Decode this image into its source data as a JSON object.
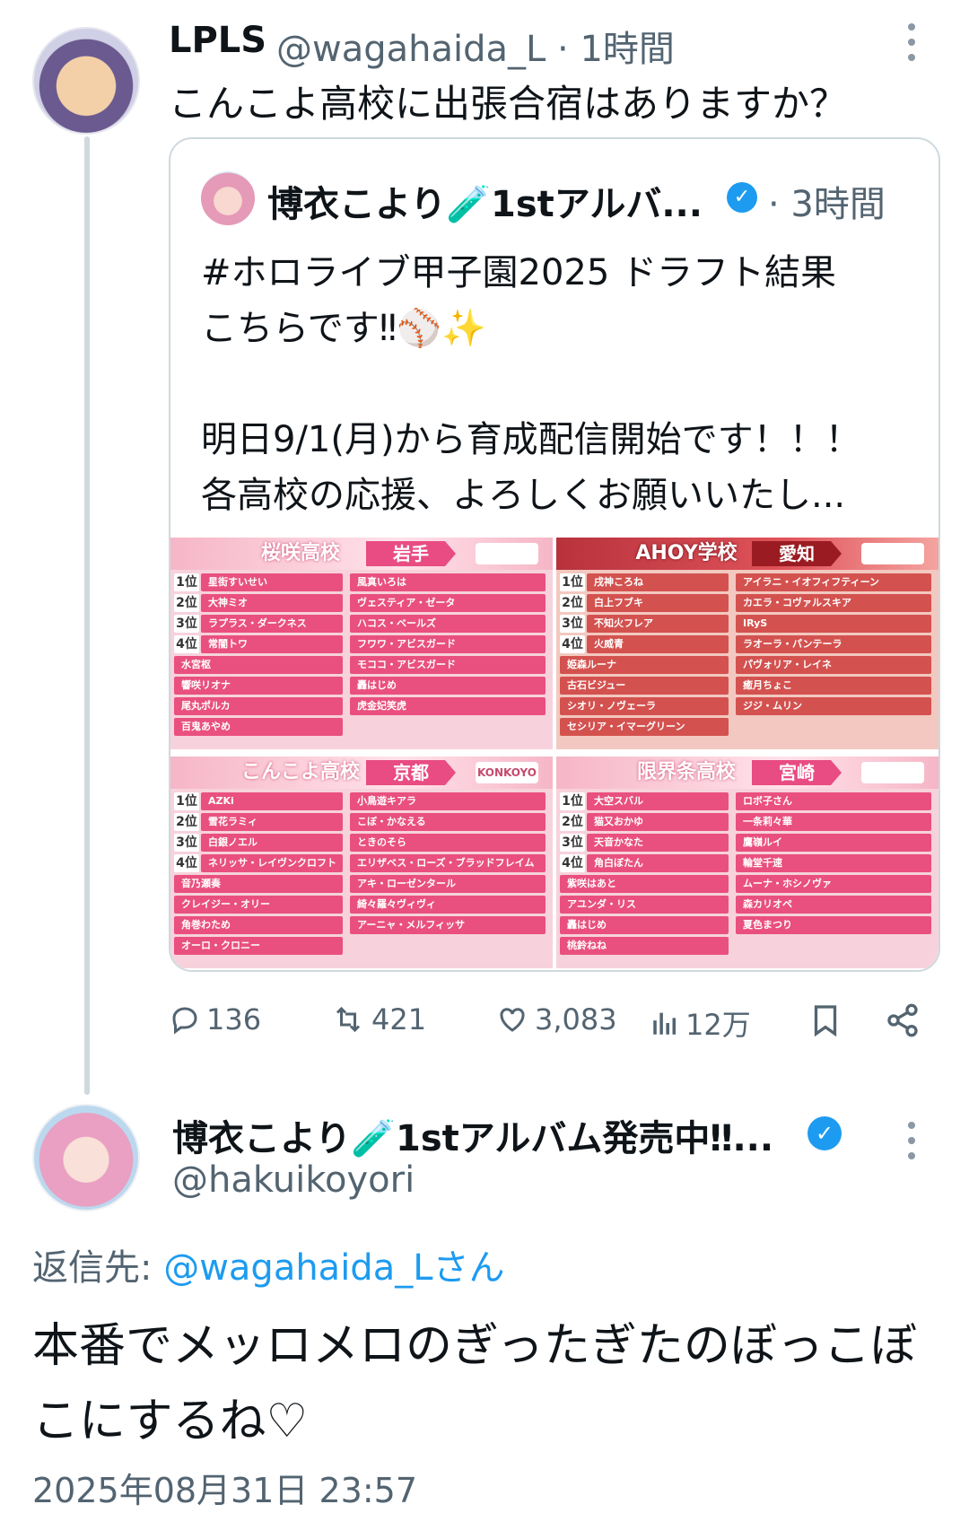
{
  "parent_tweet": {
    "name": "LPLS",
    "handle": "@wagahaida_L · 1時間",
    "text": "こんこよ高校に出張合宿はありますか？"
  },
  "quoted_tweet": {
    "name": "博衣こより🧪1stアルバ...",
    "time": "· 3時間",
    "text": "#ホロライブ甲子園2025 ドラフト結果\nこちらです‼⚾✨\n\n明日9/1(月)から育成配信開始です！！！\n各高校の応援、よろしくお願いいたし...",
    "image": {
      "panels": [
        {
          "title": "桜咲高校",
          "prefecture": "岩手",
          "logo": "",
          "ranked": [
            "星街すいせい",
            "大神ミオ",
            "ラプラス・ダークネス",
            "常闇トワ"
          ],
          "left_rest": [
            "水宮枢",
            "響咲リオナ",
            "尾丸ポルカ",
            "百鬼あやめ"
          ],
          "right": [
            "風真いろは",
            "ヴェスティア・ゼータ",
            "ハコス・ベールズ",
            "フワワ・アビスガード",
            "モココ・アビスガード",
            "轟はじめ",
            "虎金妃笑虎"
          ]
        },
        {
          "title": "AHOY学校",
          "prefecture": "愛知",
          "logo": "",
          "ranked": [
            "戌神ころね",
            "白上フブキ",
            "不知火フレア",
            "火威青"
          ],
          "left_rest": [
            "姫森ルーナ",
            "古石ビジュー",
            "シオリ・ノヴェーラ",
            "セシリア・イマーグリーン"
          ],
          "right": [
            "アイラニ・イオフィフティーン",
            "カエラ・コヴァルスキア",
            "IRyS",
            "ラオーラ・パンテーラ",
            "パヴォリア・レイネ",
            "癒月ちょこ",
            "ジジ・ムリン"
          ]
        },
        {
          "title": "こんこよ高校",
          "prefecture": "京都",
          "logo": "KONKOYO",
          "ranked": [
            "AZKi",
            "雪花ラミィ",
            "白銀ノエル",
            "ネリッサ・レイヴンクロフト"
          ],
          "left_rest": [
            "音乃瀬奏",
            "クレイジー・オリー",
            "角巻わため",
            "オーロ・クロニー"
          ],
          "right": [
            "小鳥遊キアラ",
            "こぼ・かなえる",
            "ときのそら",
            "エリザベス・ローズ・ブラッドフレイム",
            "アキ・ローゼンタール",
            "綺々羅々ヴィヴィ",
            "アーニャ・メルフィッサ"
          ]
        },
        {
          "title": "限界条高校",
          "prefecture": "宮崎",
          "logo": "",
          "ranked": [
            "大空スバル",
            "猫又おかゆ",
            "天音かなた",
            "角白ぼたん"
          ],
          "left_rest": [
            "紫咲はあと",
            "アユンダ・リス",
            "轟はじめ",
            "桃鈴ねね"
          ],
          "right": [
            "ロボ子さん",
            "一条莉々華",
            "鷹嶺ルイ",
            "輪堂千速",
            "ムーナ・ホシノヴァ",
            "森カリオペ",
            "夏色まつり"
          ]
        }
      ]
    }
  },
  "actions": {
    "replies": "136",
    "retweets": "421",
    "likes": "3,083",
    "views": "12万"
  },
  "reply_tweet": {
    "name": "博衣こより🧪1stアルバム発売中‼...",
    "handle": "@hakuikoyori",
    "reply_to_label": "返信先: ",
    "reply_to_mention": "@wagahaida_Lさん",
    "text": "本番でメッロメロのぎったぎたのぼっこぼこにするね♡",
    "timestamp": "2025年08月31日 23:57"
  },
  "icons": [
    "more-icon",
    "verified-icon",
    "reply-icon",
    "retweet-icon",
    "like-icon",
    "views-icon",
    "bookmark-icon",
    "share-icon"
  ],
  "colors": {
    "accent": "#1d9bf0",
    "secondary_text": "#536471",
    "primary_text": "#0f1419",
    "border": "#cfd9de"
  }
}
